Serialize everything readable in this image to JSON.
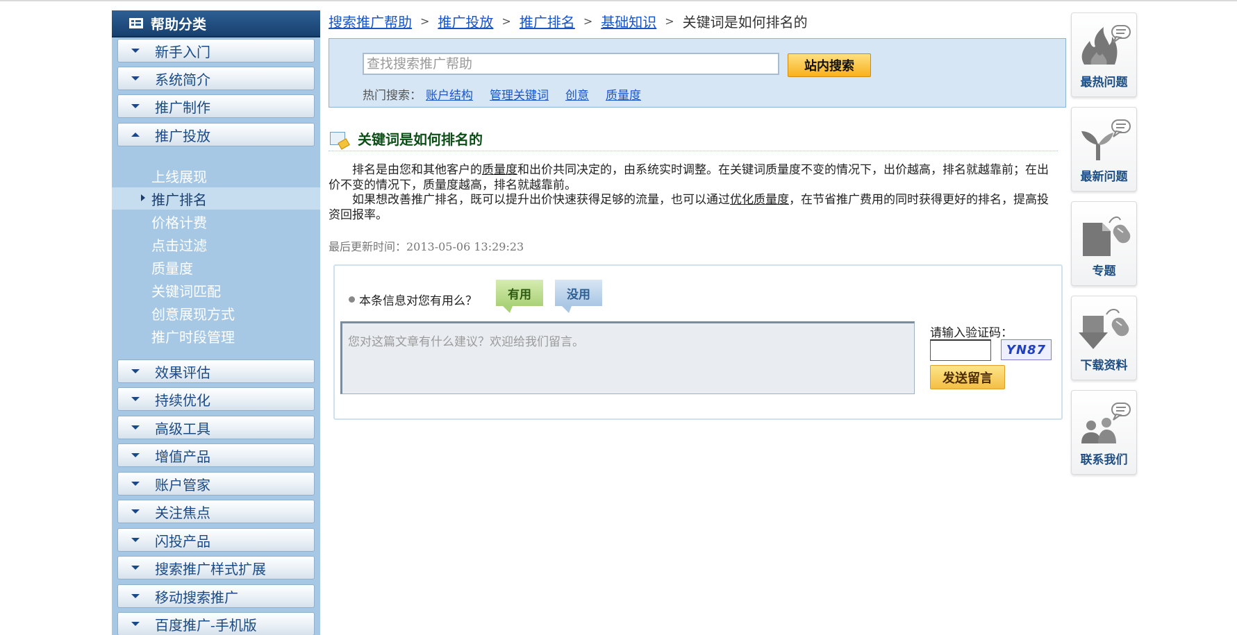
{
  "sidebar": {
    "title": "帮助分类",
    "categories_top": [
      {
        "label": "新手入门",
        "expanded": false
      },
      {
        "label": "系统简介",
        "expanded": false
      },
      {
        "label": "推广制作",
        "expanded": false
      },
      {
        "label": "推广投放",
        "expanded": true
      }
    ],
    "subitems": [
      {
        "label": "上线展现",
        "active": false
      },
      {
        "label": "推广排名",
        "active": true
      },
      {
        "label": "价格计费",
        "active": false
      },
      {
        "label": "点击过滤",
        "active": false
      },
      {
        "label": "质量度",
        "active": false
      },
      {
        "label": "关键词匹配",
        "active": false
      },
      {
        "label": "创意展现方式",
        "active": false
      },
      {
        "label": "推广时段管理",
        "active": false
      }
    ],
    "categories_bottom": [
      {
        "label": "效果评估"
      },
      {
        "label": "持续优化"
      },
      {
        "label": "高级工具"
      },
      {
        "label": "增值产品"
      },
      {
        "label": "账户管家"
      },
      {
        "label": "关注焦点"
      },
      {
        "label": "闪投产品"
      },
      {
        "label": "搜索推广样式扩展"
      },
      {
        "label": "移动搜索推广"
      },
      {
        "label": "百度推广-手机版"
      }
    ]
  },
  "breadcrumb": {
    "links": [
      "搜索推广帮助",
      "推广投放",
      "推广排名",
      "基础知识"
    ],
    "separator": ">",
    "current": "关键词是如何排名的"
  },
  "search": {
    "placeholder": "查找搜索推广帮助",
    "button_label": "站内搜索",
    "hot_label": "热门搜索：",
    "hot_links": [
      "账户结构",
      "管理关键词",
      "创意",
      "质量度"
    ]
  },
  "article": {
    "title": "关键词是如何排名的",
    "p1_a": "排名是由您和其他客户的",
    "p1_link": "质量度",
    "p1_b": "和出价共同决定的，由系统实时调整。在关键词质量度不变的情况下，出价越高，排名就越靠前；在出价不变的情况下，质量度越高，排名就越靠前。",
    "p2_a": "如果想改善推广排名，既可以提升出价快速获得足够的流量，也可以通过",
    "p2_link": "优化质量度",
    "p2_b": "，在节省推广费用的同时获得更好的排名，提高投资回报率。",
    "updated": "最后更新时间：2013-05-06 13:29:23"
  },
  "feedback": {
    "question": "本条信息对您有用么？",
    "useful_label": "有用",
    "useless_label": "没用",
    "comment_placeholder": "您对这篇文章有什么建议？欢迎给我们留言。",
    "captcha_label": "请输入验证码：",
    "captcha_text": "YN87",
    "submit_label": "发送留言"
  },
  "tools": [
    {
      "label": "最热问题",
      "icon": "fire-chat-icon"
    },
    {
      "label": "最新问题",
      "icon": "sprout-chat-icon"
    },
    {
      "label": "专题",
      "icon": "document-mouse-icon"
    },
    {
      "label": "下载资料",
      "icon": "download-mouse-icon"
    },
    {
      "label": "联系我们",
      "icon": "people-chat-icon"
    }
  ],
  "colors": {
    "sidebar_bg": "#a6c8e4",
    "sidebar_header": "#1d4a7d",
    "link": "#1a55c8",
    "article_title": "#0b4f17",
    "search_bg": "#d6e6f4",
    "search_button": "#f7b11e"
  }
}
